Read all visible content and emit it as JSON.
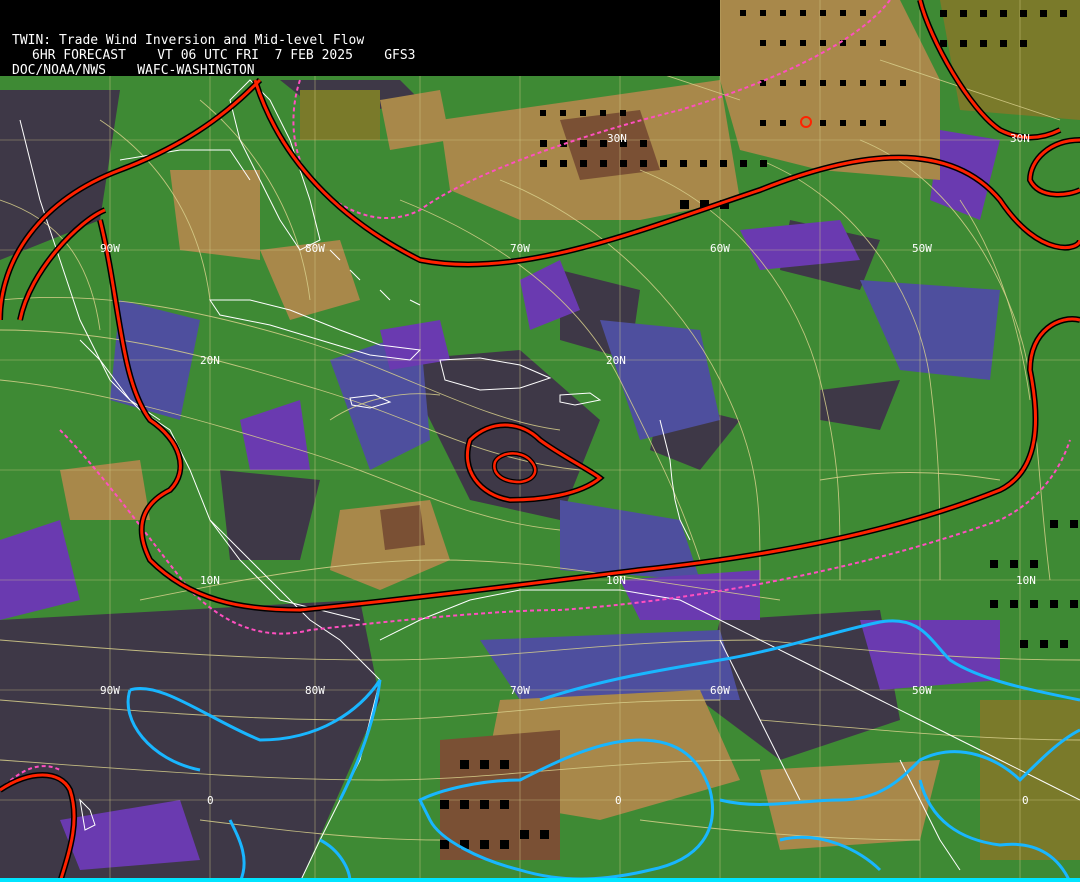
{
  "header": {
    "line1": "TWIN: Trade Wind Inversion and Mid-level Flow",
    "line2": "6HR FORECAST    VT 06 UTC FRI  7 FEB 2025    GFS3",
    "line3": "DOC/NOAA/NWS    WAFC-WASHINGTON"
  },
  "colors": {
    "dark_gray": "#3e3847",
    "blue": "#4e4f9e",
    "purple": "#6a3ab0",
    "green": "#3e8a34",
    "olive": "#7a7a2a",
    "tan": "#a8884a",
    "brown": "#7a5034",
    "red_contour": "#ff2200",
    "pink_dashed": "#ff4fc0",
    "cyan_contour": "#19b6ff",
    "streamline": "#d8d08c",
    "grid": "#d8d08c",
    "coastline": "#ffffff"
  },
  "latitude_labels": [
    "30N",
    "30N",
    "20N",
    "20N",
    "10N",
    "10N",
    "10N",
    "0",
    "0",
    "0"
  ],
  "longitude_labels": [
    "90W",
    "80W",
    "70W",
    "60W",
    "50W",
    "90W",
    "80W",
    "70W",
    "60W",
    "50W"
  ]
}
